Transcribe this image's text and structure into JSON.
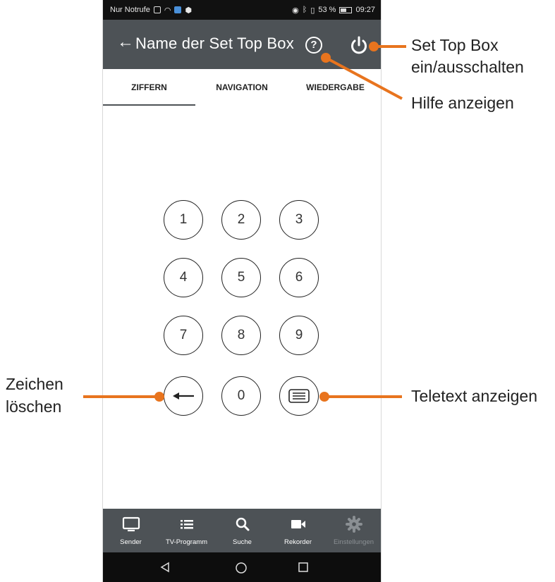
{
  "status_bar": {
    "carrier": "Nur Notrufe",
    "battery_percent": "53 %",
    "time": "09:27"
  },
  "app_bar": {
    "back_icon": "arrow-left-icon",
    "title": "Name der Set Top Box",
    "help_icon": "help-icon",
    "power_icon": "power-icon"
  },
  "tabs": [
    {
      "label": "ZIFFERN",
      "active": true
    },
    {
      "label": "NAVIGATION",
      "active": false
    },
    {
      "label": "WIEDERGABE",
      "active": false
    }
  ],
  "keypad": {
    "digits": [
      "1",
      "2",
      "3",
      "4",
      "5",
      "6",
      "7",
      "8",
      "9",
      "0"
    ],
    "delete_icon": "arrow-left-icon",
    "teletext_icon": "teletext-icon"
  },
  "bottom_nav": [
    {
      "label": "Sender",
      "icon": "tv-icon",
      "enabled": true
    },
    {
      "label": "TV-Programm",
      "icon": "list-icon",
      "enabled": true
    },
    {
      "label": "Suche",
      "icon": "search-icon",
      "enabled": true
    },
    {
      "label": "Rekorder",
      "icon": "camera-icon",
      "enabled": true
    },
    {
      "label": "Einstellungen",
      "icon": "gear-icon",
      "enabled": false
    }
  ],
  "system_nav": [
    "back-triangle-icon",
    "home-circle-icon",
    "recents-square-icon"
  ],
  "annotations": {
    "power_line1": "Set Top Box",
    "power_line2": "ein/ausschalten",
    "help": "Hilfe anzeigen",
    "delete_line1": "Zeichen",
    "delete_line2": "löschen",
    "teletext": "Teletext anzeigen"
  },
  "colors": {
    "app_bar": "#4d5256",
    "annotation": "#e8741e",
    "status_bar": "#111111"
  }
}
